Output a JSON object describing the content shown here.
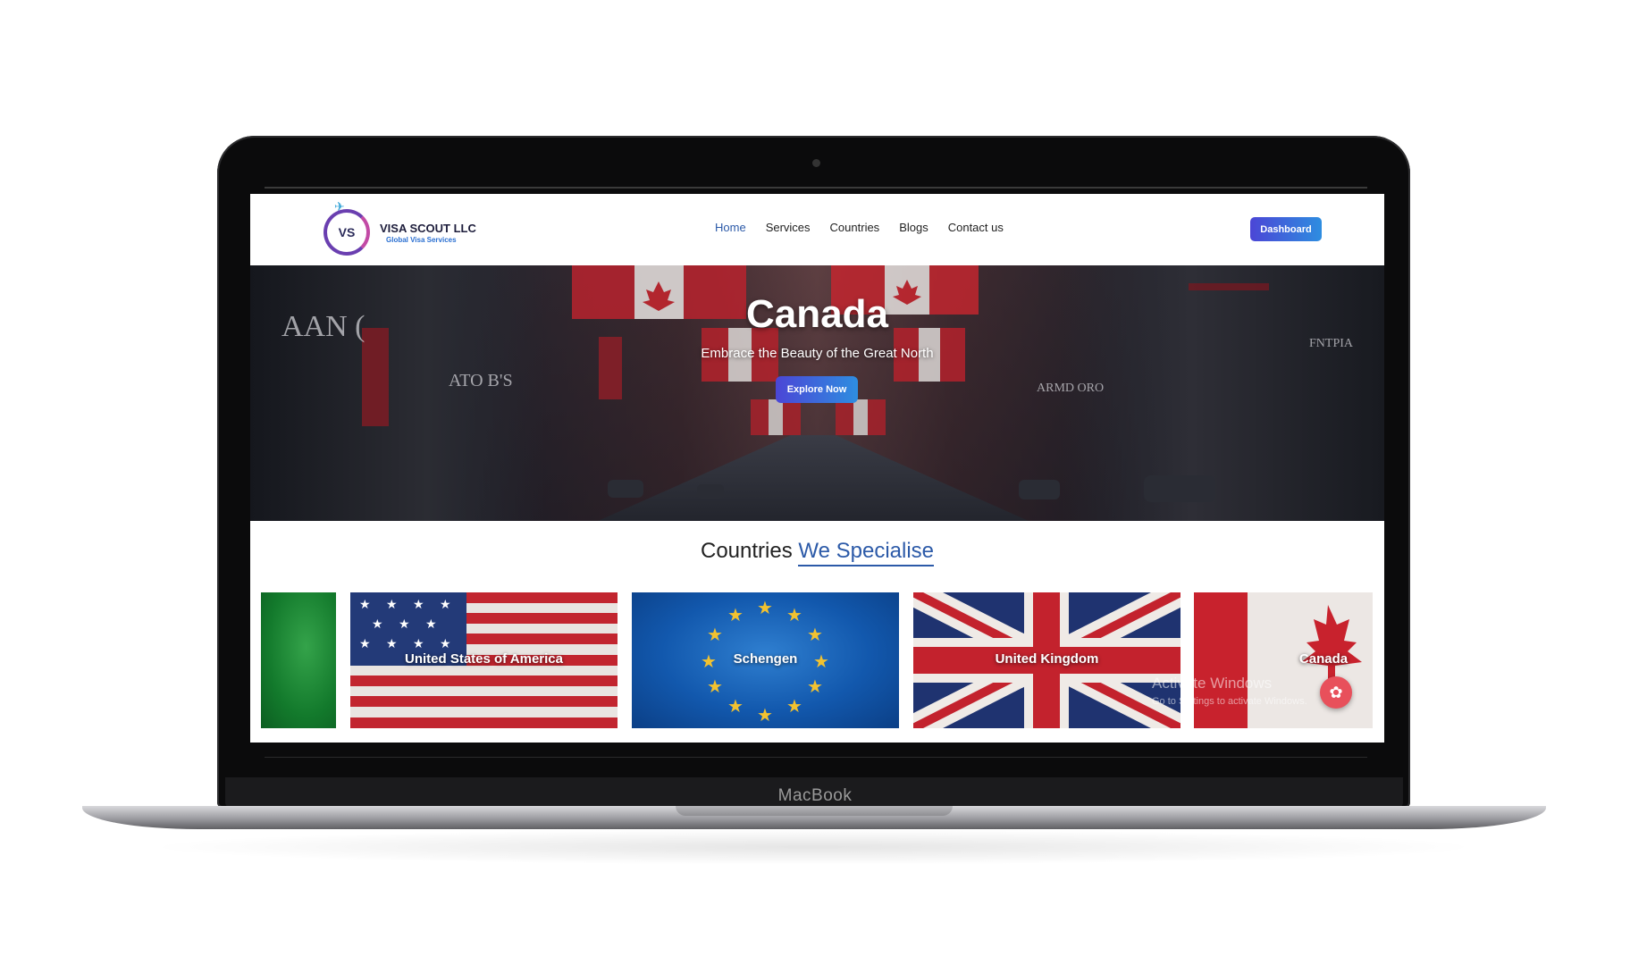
{
  "device": {
    "chin_label": "MacBook"
  },
  "header": {
    "logo_name": "VISA SCOUT LLC",
    "logo_tagline": "Global Visa Services",
    "logo_initials": "VS",
    "nav": [
      {
        "label": "Home",
        "active": true
      },
      {
        "label": "Services",
        "active": false
      },
      {
        "label": "Countries",
        "active": false
      },
      {
        "label": "Blogs",
        "active": false
      },
      {
        "label": "Contact us",
        "active": false
      }
    ],
    "dashboard_label": "Dashboard"
  },
  "hero": {
    "title": "Canada",
    "subtitle": "Embrace the Beauty of the Great North",
    "cta_label": "Explore Now"
  },
  "countries": {
    "title_prefix": "Countries",
    "title_accent": "We Specialise",
    "cards": [
      {
        "label": ""
      },
      {
        "label": "United States of America"
      },
      {
        "label": "Schengen"
      },
      {
        "label": "United Kingdom"
      },
      {
        "label": "Canada"
      }
    ]
  },
  "watermark": {
    "line1": "Activate Windows",
    "line2": "Go to Settings to activate Windows."
  },
  "colors": {
    "accent": "#2c5aa8",
    "button_gradient_start": "#4b46d6",
    "button_gradient_end": "#2e8de0",
    "fab": "#e8505b"
  },
  "icons": {
    "floating_button": "gear-icon",
    "logo_plane": "airplane-icon"
  }
}
